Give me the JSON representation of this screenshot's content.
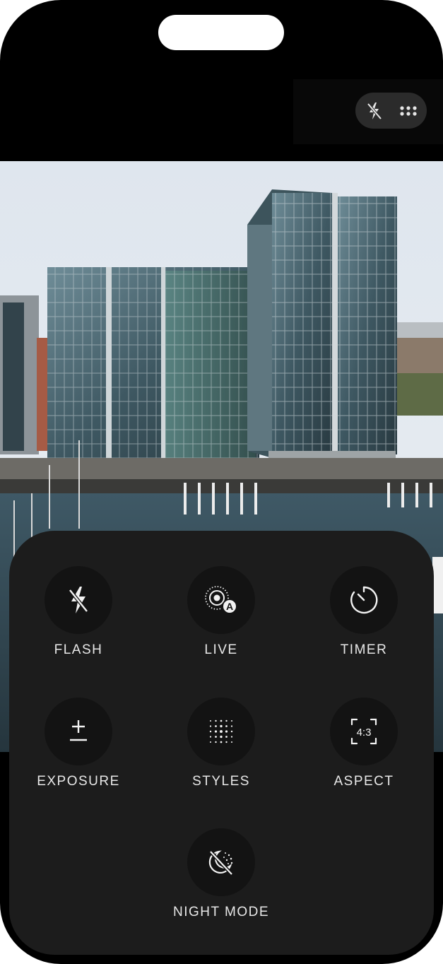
{
  "top_bar": {
    "flash_icon": "flash-off-icon",
    "more_icon": "grid-dots-icon"
  },
  "controls": [
    {
      "label": "FLASH",
      "icon": "flash-off-icon"
    },
    {
      "label": "LIVE",
      "icon": "live-photo-auto-icon"
    },
    {
      "label": "TIMER",
      "icon": "timer-icon"
    },
    {
      "label": "EXPOSURE",
      "icon": "exposure-plus-minus-icon"
    },
    {
      "label": "STYLES",
      "icon": "styles-dots-icon"
    },
    {
      "label": "ASPECT",
      "icon": "aspect-ratio-icon",
      "value": "4:3"
    },
    {
      "label": "NIGHT MODE",
      "icon": "night-mode-off-icon"
    }
  ],
  "colors": {
    "sheet_bg": "#1c1c1c",
    "button_bg": "#131313",
    "label": "#e8e8e8"
  }
}
